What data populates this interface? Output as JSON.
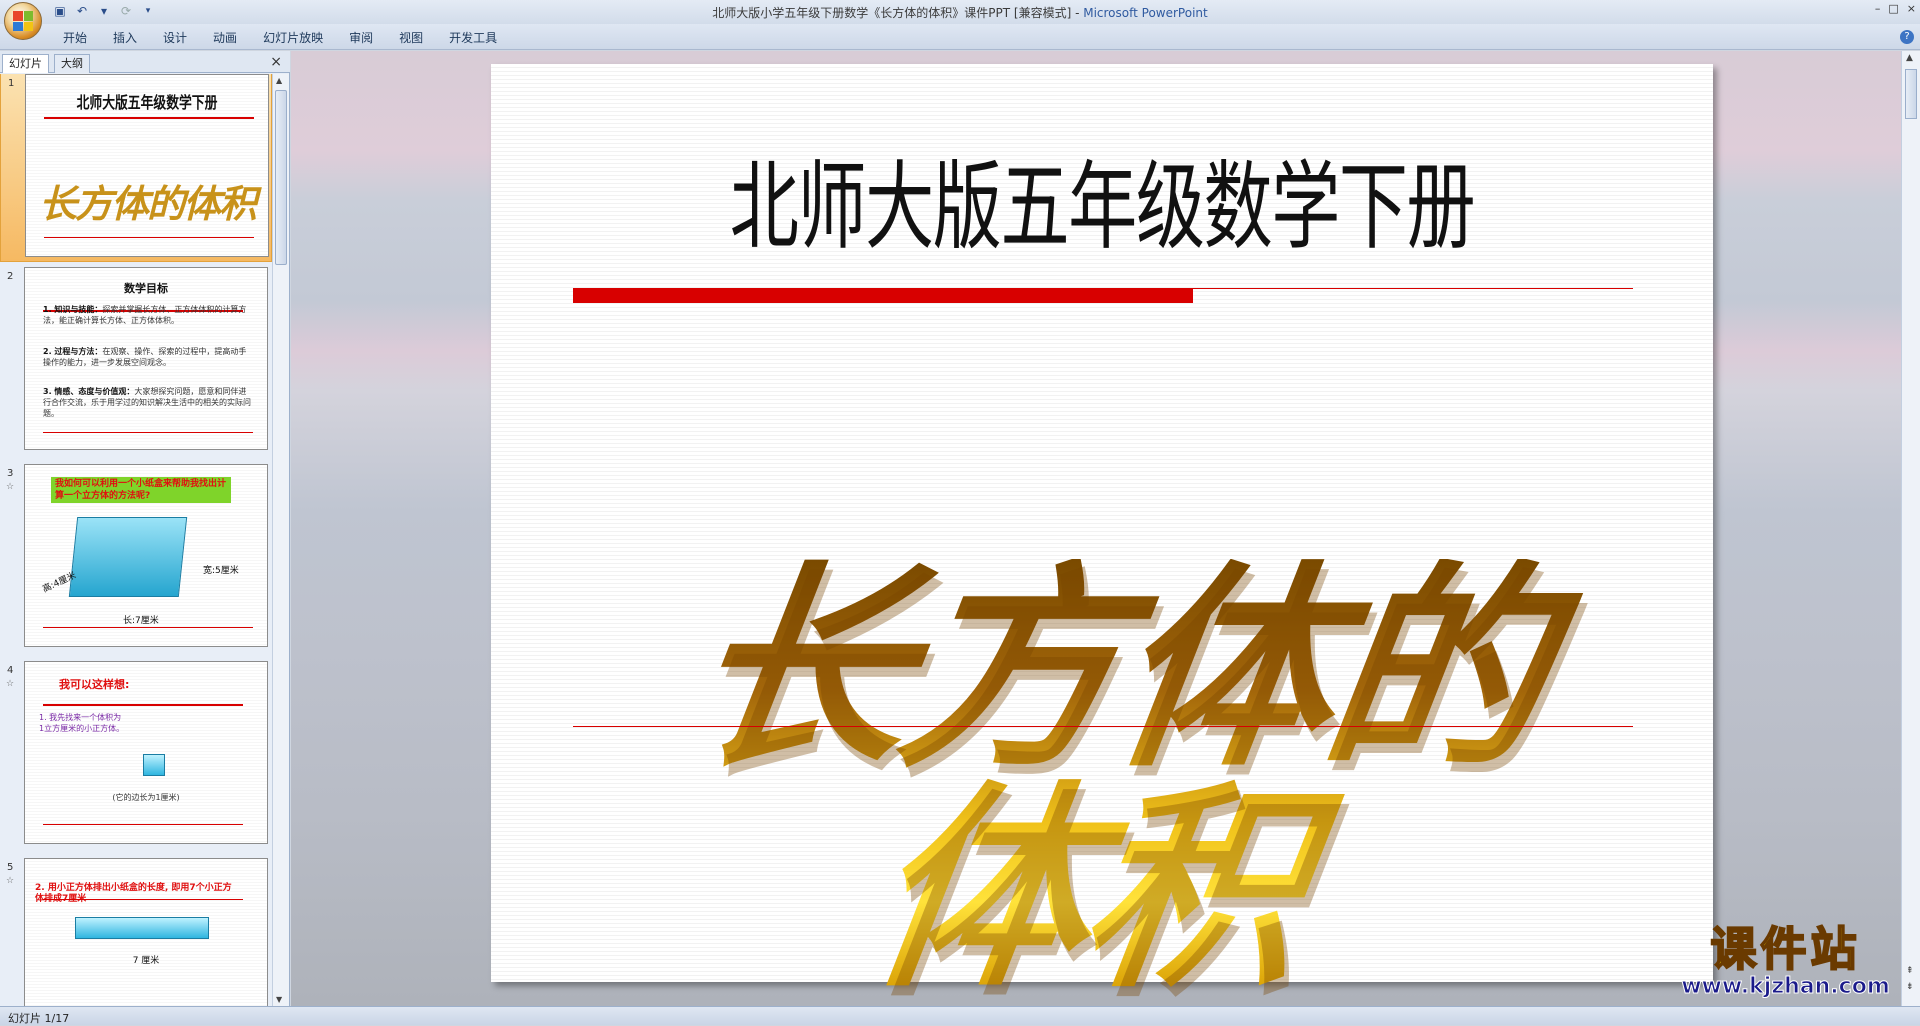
{
  "window": {
    "title": "北师大版小学五年级下册数学《长方体的体积》课件PPT [兼容模式] - ",
    "app_name": "Microsoft PowerPoint",
    "controls": [
      "–",
      "□",
      "×"
    ]
  },
  "ribbon": {
    "tabs": [
      "开始",
      "插入",
      "设计",
      "动画",
      "幻灯片放映",
      "审阅",
      "视图",
      "开发工具"
    ],
    "help": "?"
  },
  "panel": {
    "tabs": [
      "幻灯片",
      "大纲"
    ],
    "close": "×"
  },
  "thumbnails": [
    {
      "num": "1",
      "title": "北师大版五年级数学下册",
      "subtitle": "长方体的体积"
    },
    {
      "num": "2",
      "title": "数学目标",
      "items": [
        {
          "head": "1. 知识与技能：",
          "text": "探索并掌握长方体、正方体体积的计算方法，能正确计算长方体、正方体体积。"
        },
        {
          "head": "2. 过程与方法：",
          "text": "在观察、操作、探索的过程中，提高动手操作的能力，进一步发展空间观念。"
        },
        {
          "head": "3. 情感、态度与价值观：",
          "text": "大家想探究问题，愿意和同伴进行合作交流，乐于用学过的知识解决生活中的相关的实际问题。"
        }
      ]
    },
    {
      "num": "3",
      "star": "☆",
      "question": "我如何可以利用一个小纸盒来帮助我找出计算一个立方体的方法呢?",
      "labels": [
        "高:4厘米",
        "宽:5厘米",
        "长:7厘米"
      ]
    },
    {
      "num": "4",
      "star": "☆",
      "title": "我可以这样想:",
      "text": "1. 我先找来一个体积为\n1立方厘米的小正方体。",
      "caption": "(它的边长为1厘米)"
    },
    {
      "num": "5",
      "star": "☆",
      "title": "2. 用小正方体排出小纸盒的长度, 即用7个小正方体排成7厘米",
      "caption": "7 厘米"
    }
  ],
  "slide": {
    "title": "北师大版五年级数学下册",
    "main_text": "长方体的体积"
  },
  "status": {
    "slide_indicator": "幻灯片 1/17"
  },
  "watermark": {
    "name": "课件站",
    "url": "www.kjzhan.com"
  }
}
